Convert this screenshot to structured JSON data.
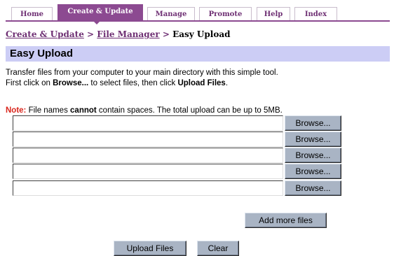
{
  "tabs": [
    {
      "label": "Home",
      "active": false
    },
    {
      "label": "Create & Update",
      "active": true
    },
    {
      "label": "Manage",
      "active": false
    },
    {
      "label": "Promote",
      "active": false
    },
    {
      "label": "Help",
      "active": false
    },
    {
      "label": "Index",
      "active": false
    }
  ],
  "breadcrumb": {
    "link1": "Create & Update",
    "link2": "File Manager",
    "separator": ">",
    "current": "Easy Upload"
  },
  "section": {
    "title": "Easy Upload"
  },
  "description": {
    "line1": "Transfer files from your computer to your main directory with this simple tool.",
    "line2_prefix": "First click on ",
    "line2_bold1": "Browse...",
    "line2_mid": " to select files, then click ",
    "line2_bold2": "Upload Files",
    "line2_suffix": "."
  },
  "note": {
    "label": "Note:",
    "text_prefix": " File names ",
    "text_bold": "cannot",
    "text_suffix": " contain spaces. The total upload can be up to 5MB."
  },
  "file_rows": [
    {
      "value": "",
      "browse_label": "Browse..."
    },
    {
      "value": "",
      "browse_label": "Browse..."
    },
    {
      "value": "",
      "browse_label": "Browse..."
    },
    {
      "value": "",
      "browse_label": "Browse..."
    },
    {
      "value": "",
      "browse_label": "Browse..."
    }
  ],
  "buttons": {
    "add_more": "Add more files",
    "upload": "Upload Files",
    "clear": "Clear"
  },
  "colors": {
    "accent": "#8c4a91",
    "section_bg": "#cccdf5",
    "note_red": "#d9261c",
    "button_bg": "#a9b4c4"
  }
}
